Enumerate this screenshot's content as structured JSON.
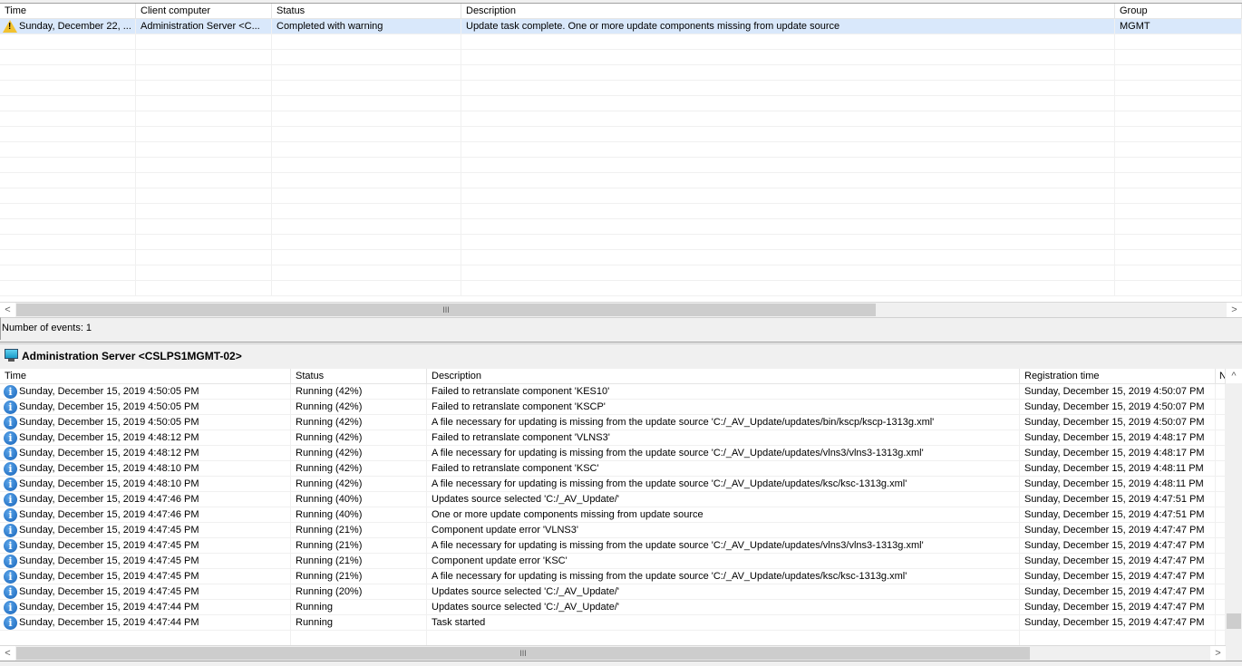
{
  "top_table": {
    "columns": [
      "Time",
      "Client computer",
      "Status",
      "Description",
      "Group"
    ],
    "rows": [
      {
        "icon": "warning",
        "cells": [
          "Sunday, December 22, ...",
          "Administration Server <C...",
          "Completed with warning",
          "Update task complete. One or more update components missing from update source",
          "MGMT"
        ]
      }
    ],
    "scrollbar": {
      "thumb_glyph": "III"
    }
  },
  "status_bar": {
    "events_text": "Number of events: 1"
  },
  "detail_panel": {
    "title": "Administration Server <CSLPS1MGMT-02>",
    "columns": [
      "Time",
      "Status",
      "Description",
      "Registration time",
      "N"
    ],
    "rows": [
      [
        "Sunday, December 15, 2019 4:50:05 PM",
        "Running (42%)",
        "Failed to retranslate component 'KES10'",
        "Sunday, December 15, 2019 4:50:07 PM"
      ],
      [
        "Sunday, December 15, 2019 4:50:05 PM",
        "Running (42%)",
        "Failed to retranslate component 'KSCP'",
        "Sunday, December 15, 2019 4:50:07 PM"
      ],
      [
        "Sunday, December 15, 2019 4:50:05 PM",
        "Running (42%)",
        "A file necessary for updating is missing from the update source 'C:/_AV_Update/updates/bin/kscp/kscp-1313g.xml'",
        "Sunday, December 15, 2019 4:50:07 PM"
      ],
      [
        "Sunday, December 15, 2019 4:48:12 PM",
        "Running (42%)",
        "Failed to retranslate component 'VLNS3'",
        "Sunday, December 15, 2019 4:48:17 PM"
      ],
      [
        "Sunday, December 15, 2019 4:48:12 PM",
        "Running (42%)",
        "A file necessary for updating is missing from the update source 'C:/_AV_Update/updates/vlns3/vlns3-1313g.xml'",
        "Sunday, December 15, 2019 4:48:17 PM"
      ],
      [
        "Sunday, December 15, 2019 4:48:10 PM",
        "Running (42%)",
        "Failed to retranslate component 'KSC'",
        "Sunday, December 15, 2019 4:48:11 PM"
      ],
      [
        "Sunday, December 15, 2019 4:48:10 PM",
        "Running (42%)",
        "A file necessary for updating is missing from the update source 'C:/_AV_Update/updates/ksc/ksc-1313g.xml'",
        "Sunday, December 15, 2019 4:48:11 PM"
      ],
      [
        "Sunday, December 15, 2019 4:47:46 PM",
        "Running (40%)",
        "Updates source selected 'C:/_AV_Update/'",
        "Sunday, December 15, 2019 4:47:51 PM"
      ],
      [
        "Sunday, December 15, 2019 4:47:46 PM",
        "Running (40%)",
        "One or more update components missing from update source",
        "Sunday, December 15, 2019 4:47:51 PM"
      ],
      [
        "Sunday, December 15, 2019 4:47:45 PM",
        "Running (21%)",
        "Component update error 'VLNS3'",
        "Sunday, December 15, 2019 4:47:47 PM"
      ],
      [
        "Sunday, December 15, 2019 4:47:45 PM",
        "Running (21%)",
        "A file necessary for updating is missing from the update source 'C:/_AV_Update/updates/vlns3/vlns3-1313g.xml'",
        "Sunday, December 15, 2019 4:47:47 PM"
      ],
      [
        "Sunday, December 15, 2019 4:47:45 PM",
        "Running (21%)",
        "Component update error 'KSC'",
        "Sunday, December 15, 2019 4:47:47 PM"
      ],
      [
        "Sunday, December 15, 2019 4:47:45 PM",
        "Running (21%)",
        "A file necessary for updating is missing from the update source 'C:/_AV_Update/updates/ksc/ksc-1313g.xml'",
        "Sunday, December 15, 2019 4:47:47 PM"
      ],
      [
        "Sunday, December 15, 2019 4:47:45 PM",
        "Running (20%)",
        "Updates source selected 'C:/_AV_Update/'",
        "Sunday, December 15, 2019 4:47:47 PM"
      ],
      [
        "Sunday, December 15, 2019 4:47:44 PM",
        "Running",
        "Updates source selected 'C:/_AV_Update/'",
        "Sunday, December 15, 2019 4:47:47 PM"
      ],
      [
        "Sunday, December 15, 2019 4:47:44 PM",
        "Running",
        "Task started",
        "Sunday, December 15, 2019 4:47:47 PM"
      ]
    ]
  },
  "icons": {
    "warning": "warning-triangle-icon",
    "info": "info-icon",
    "server": "computer-monitor-icon"
  },
  "glyphs": {
    "left": "<",
    "right": ">",
    "up": "^",
    "thumb": "III",
    "info": "i",
    "warn": "!"
  }
}
